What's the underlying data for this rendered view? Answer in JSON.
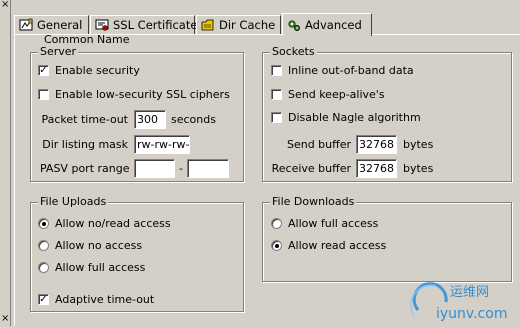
{
  "window": {
    "close_glyph": "×",
    "bottom_glyph": "×"
  },
  "tabs": [
    {
      "label": "General",
      "icon": "general-tab-icon",
      "active": false
    },
    {
      "label": "SSL Certificate",
      "icon": "ssl-certificate-icon",
      "active": false
    },
    {
      "label": "Dir Cache",
      "icon": "dir-cache-icon",
      "active": false
    },
    {
      "label": "Advanced",
      "icon": "advanced-icon",
      "active": true
    }
  ],
  "cutoff_text": "Common Name",
  "server": {
    "legend": "Server",
    "enable_security": {
      "label": "Enable security",
      "checked": true
    },
    "low_security": {
      "label": "Enable low-security SSL ciphers",
      "checked": false
    },
    "packet_timeout": {
      "label": "Packet time-out",
      "value": "300",
      "unit": "seconds"
    },
    "dir_mask": {
      "label": "Dir listing mask",
      "value": "rw-rw-rw-"
    },
    "pasv": {
      "label": "PASV port range",
      "from": "",
      "separator": "-",
      "to": ""
    }
  },
  "sockets": {
    "legend": "Sockets",
    "inline_oob": {
      "label": "Inline out-of-band data",
      "checked": false
    },
    "keep_alive": {
      "label": "Send keep-alive's",
      "checked": false
    },
    "nagle": {
      "label": "Disable Nagle algorithm",
      "checked": false
    },
    "send_buffer": {
      "label": "Send buffer",
      "value": "32768",
      "unit": "bytes"
    },
    "receive_buffer": {
      "label": "Receive buffer",
      "value": "32768",
      "unit": "bytes"
    }
  },
  "uploads": {
    "legend": "File Uploads",
    "options": [
      {
        "label": "Allow no/read access",
        "selected": true
      },
      {
        "label": "Allow no access",
        "selected": false
      },
      {
        "label": "Allow full access",
        "selected": false
      }
    ],
    "adaptive": {
      "label": "Adaptive time-out",
      "checked": true
    }
  },
  "downloads": {
    "legend": "File Downloads",
    "options": [
      {
        "label": "Allow full access",
        "selected": false
      },
      {
        "label": "Allow read access",
        "selected": true
      }
    ]
  },
  "watermark": {
    "cn": "运维网",
    "url": "iyunv.com",
    "accent": "#1e88d8"
  },
  "check_glyph": "✓"
}
